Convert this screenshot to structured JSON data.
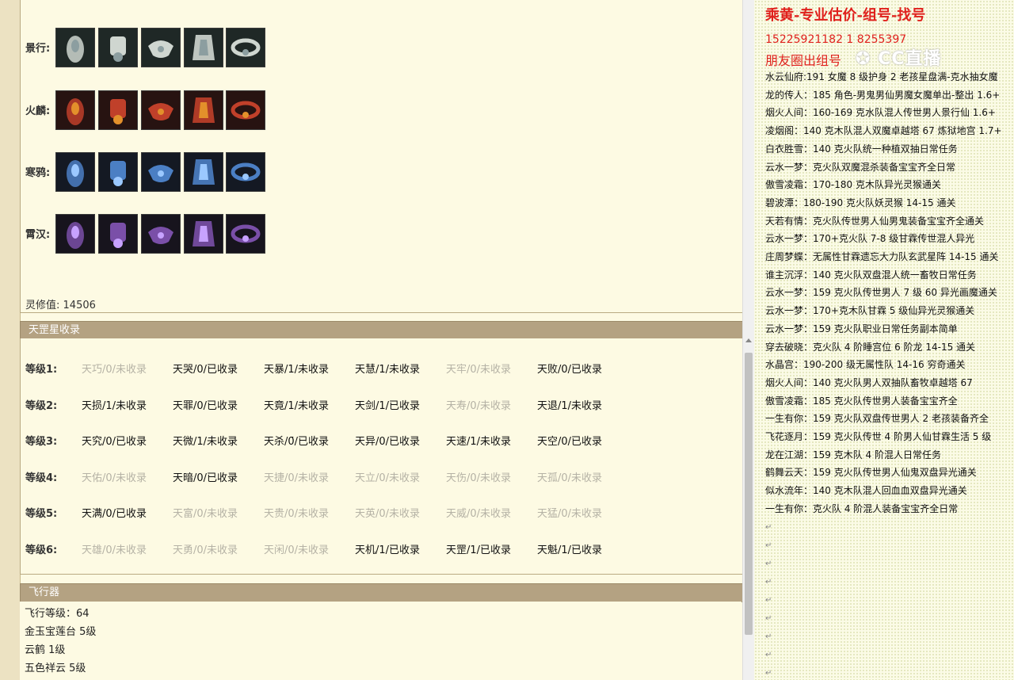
{
  "equipment": {
    "rows": [
      {
        "label": "景行:"
      },
      {
        "label": "火麟:"
      },
      {
        "label": "寒鸦:"
      },
      {
        "label": "霄汉:"
      }
    ],
    "lingxiu_label": "灵修值:",
    "lingxiu_value": "14506"
  },
  "star_section": {
    "title": "天罡星收录",
    "levels": [
      {
        "label": "等级1:",
        "items": [
          {
            "text": "天巧/0/未收录",
            "collected": false
          },
          {
            "text": "天哭/0/已收录",
            "collected": true
          },
          {
            "text": "天暴/1/未收录",
            "collected": true
          },
          {
            "text": "天慧/1/未收录",
            "collected": true
          },
          {
            "text": "天牢/0/未收录",
            "collected": false
          },
          {
            "text": "天败/0/已收录",
            "collected": true
          }
        ]
      },
      {
        "label": "等级2:",
        "items": [
          {
            "text": "天损/1/未收录",
            "collected": true
          },
          {
            "text": "天罪/0/已收录",
            "collected": true
          },
          {
            "text": "天竟/1/未收录",
            "collected": true
          },
          {
            "text": "天剑/1/已收录",
            "collected": true
          },
          {
            "text": "天寿/0/未收录",
            "collected": false
          },
          {
            "text": "天退/1/未收录",
            "collected": true
          }
        ]
      },
      {
        "label": "等级3:",
        "items": [
          {
            "text": "天究/0/已收录",
            "collected": true
          },
          {
            "text": "天微/1/未收录",
            "collected": true
          },
          {
            "text": "天杀/0̄/已收录",
            "collected": true
          },
          {
            "text": "天异/0/已收录",
            "collected": true
          },
          {
            "text": "天速/1/未收录",
            "collected": true
          },
          {
            "text": "天空/0/已收录",
            "collected": true
          }
        ]
      },
      {
        "label": "等级4:",
        "items": [
          {
            "text": "天佑/0/未收录",
            "collected": false
          },
          {
            "text": "天暗/0/已收录",
            "collected": true
          },
          {
            "text": "天捷/0/未收录",
            "collected": false
          },
          {
            "text": "天立/0/未收录",
            "collected": false
          },
          {
            "text": "天伤/0/未收录",
            "collected": false
          },
          {
            "text": "天孤/0/未收录",
            "collected": false
          }
        ]
      },
      {
        "label": "等级5:",
        "items": [
          {
            "text": "天满/0/已收录",
            "collected": true
          },
          {
            "text": "天富/0/未收录",
            "collected": false
          },
          {
            "text": "天贵/0/未收录",
            "collected": false
          },
          {
            "text": "天英/0/未收录",
            "collected": false
          },
          {
            "text": "天威/0/未收录",
            "collected": false
          },
          {
            "text": "天猛/0/未收录",
            "collected": false
          }
        ]
      },
      {
        "label": "等级6:",
        "items": [
          {
            "text": "天雄/0/未收录",
            "collected": false
          },
          {
            "text": "天勇/0/未收录",
            "collected": false
          },
          {
            "text": "天闲/0/未收录",
            "collected": false
          },
          {
            "text": "天机/1/已收录",
            "collected": true
          },
          {
            "text": "天罡/1/已收录",
            "collected": true
          },
          {
            "text": "天魁/1/已收录",
            "collected": true
          }
        ]
      }
    ]
  },
  "flyer_section": {
    "title": "飞行器",
    "lines": [
      "飞行等级：64",
      "金玉宝莲台  5级",
      "云鹤  1级",
      "五色祥云  5级"
    ]
  },
  "ad_panel": {
    "title": "乘黄-专业估价-组号-找号",
    "phone": "15225921182   1   8255397",
    "circle_text": "朋友圈出组号",
    "watermark": "✪ CC直播",
    "lines": [
      "水云仙府:191 女魔 8 级护身 2 老孩星盘满-克水抽女魔",
      "龙的传人：185 角色-男鬼男仙男魔女魔单出-整出 1.6+",
      "烟火人间：160-169 克水队混人传世男人景行仙 1.6+",
      "凌烟阁：140 克木队混人双魔卓越塔 67 炼狱地宫 1.7+",
      "白衣胜雪：140 克火队统一种植双抽日常任务",
      "云水一梦：克火队双魔混杀装备宝宝齐全日常",
      "傲雪凌霜：170-180 克木队异光灵猴通关",
      "碧波潭：180-190 克火队妖灵猴 14-15 通关",
      "天若有情：克火队传世男人仙男鬼装备宝宝齐全通关",
      "云水一梦：170+克火队 7-8 级甘霖传世混人异光",
      "庄周梦蝶：无属性甘霖遗忘大力队玄武星阵 14-15 通关",
      "谁主沉浮：140 克火队双盘混人统一畜牧日常任务",
      "云水一梦：159 克火队传世男人 7 级 60 异光画魔通关",
      "云水一梦：170+克木队甘霖 5 级仙异光灵猴通关",
      "云水一梦：159 克火队职业日常任务副本简单",
      "穿去破晓：克火队 4 阶睡宫位 6 阶龙 14-15 通关",
      "水晶宫：190-200 级无属性队 14-16 穷奇通关",
      "烟火人间：140 克火队男人双抽队畜牧卓越塔 67",
      "傲雪凌霜：185 克火队传世男人装备宝宝齐全",
      "一生有你：159 克火队双盘传世男人 2 老孩装备齐全",
      "飞花逐月：159 克火队传世 4 阶男人仙甘霖生活 5 级",
      "龙在江湖：159 克木队 4 阶混人日常任务",
      "鹤舞云天：159 克火队传世男人仙鬼双盘异光通关",
      "似水流年：140 克木队混人回血血双盘异光通关",
      "一生有你：克火队 4 阶混人装备宝宝齐全日常"
    ],
    "para_mark": "↵"
  }
}
